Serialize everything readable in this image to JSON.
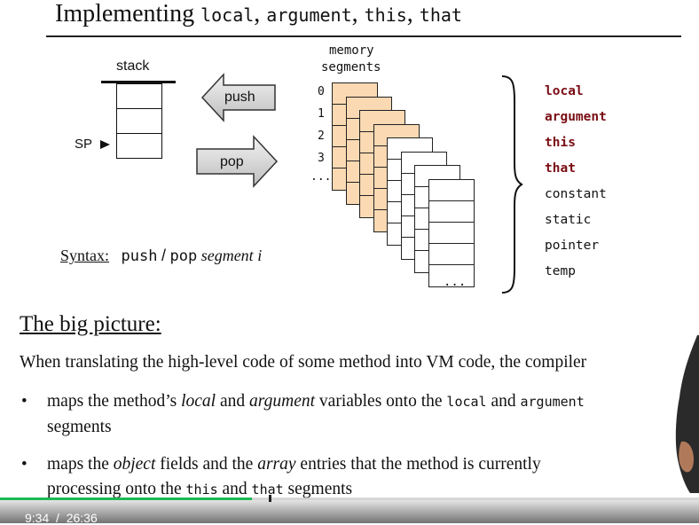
{
  "slide": {
    "title_text": "Implementing",
    "title_code": [
      "local",
      "argument",
      "this",
      "that"
    ],
    "title_sep": ", "
  },
  "stack": {
    "label": "stack",
    "sp_label": "SP"
  },
  "arrows": {
    "push_label": "push",
    "pop_label": "pop"
  },
  "memory": {
    "label_line1": "memory",
    "label_line2": "segments",
    "indices": [
      "0",
      "1",
      "2",
      "3",
      "..."
    ],
    "last_card_text": "...",
    "segments": [
      {
        "name": "local",
        "highlight": true
      },
      {
        "name": "argument",
        "highlight": true
      },
      {
        "name": "this",
        "highlight": true
      },
      {
        "name": "that",
        "highlight": true
      },
      {
        "name": "constant",
        "highlight": false
      },
      {
        "name": "static",
        "highlight": false
      },
      {
        "name": "pointer",
        "highlight": false
      },
      {
        "name": "temp",
        "highlight": false
      }
    ],
    "highlight_color": "#7a0e14",
    "card_fill": "#fbd9b3"
  },
  "syntax": {
    "label": "Syntax:",
    "push": "push",
    "slash": "/",
    "pop": "pop",
    "segment": "segment",
    "index": "i"
  },
  "big_picture": {
    "heading": "The big picture:",
    "intro": "When translating the high-level code of some method into VM code, the compiler",
    "bullets": [
      {
        "line1_a": "maps the method’s ",
        "line1_b": "local",
        "line1_c": " and ",
        "line1_d": "argument",
        "line1_e": " variables onto the ",
        "line1_f": "local",
        "line1_g": " and ",
        "line1_h": "argument",
        "line2": "segments"
      },
      {
        "line1_a": "maps the ",
        "line1_b": "object",
        "line1_c": " fields and the ",
        "line1_d": "array",
        "line1_e": " entries that the method is currently",
        "line2_a": "processing onto the ",
        "line2_b": "this",
        "line2_c": " and ",
        "line2_d": "that",
        "line2_e": " segments"
      }
    ]
  },
  "player": {
    "current_time": "9:34",
    "separator": "/",
    "duration": "26:36",
    "progress_fraction": 0.36,
    "progress_color": "#1db954"
  }
}
